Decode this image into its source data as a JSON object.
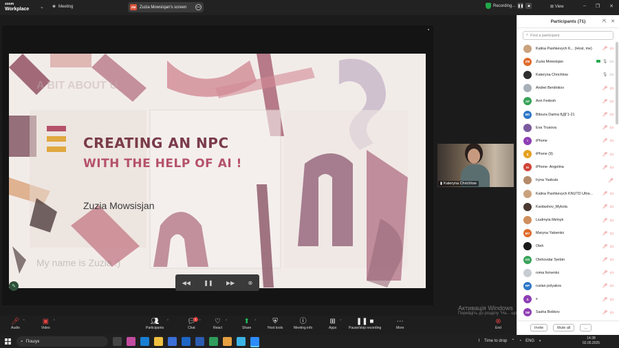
{
  "app": {
    "logo_line1": "zoom",
    "logo_line2": "Workplace"
  },
  "topbar": {
    "meeting_label": "Meeting",
    "share_badge": "ZM",
    "share_label": "Zuzia Mowsisjan's screen",
    "recording_label": "Recording...",
    "view_label": "View"
  },
  "slide": {
    "ghost_top": "A BIT ABOUT U",
    "title_line1": "CREATING AN NPC",
    "title_line2": "WITH THE HELP OF AI !",
    "presenter": "Zuzia Mowsisjan",
    "ghost_bottom": "My name is Zuzia :)"
  },
  "video_tile": {
    "name": "Kateryna Chrichlow"
  },
  "watermark": {
    "line1": "Активація Windows",
    "line2": "Перейдіть до розділу \"На... щоб активувати Windows."
  },
  "participants": {
    "title": "Participants (71)",
    "search_placeholder": "Find a participant",
    "items": [
      {
        "name": "Kalina Pashkevych K... (Host, me)",
        "initials": "",
        "color": "#c9a27e",
        "mic": "off",
        "cam": "off"
      },
      {
        "name": "Zuzia Mowsisjan",
        "initials": "ZM",
        "color": "#e06b2a",
        "mic": "on",
        "cam": "on",
        "sharing": true
      },
      {
        "name": "Kateryna Chrichlow",
        "initials": "",
        "color": "#2f2f2f",
        "mic": "on",
        "cam": "on"
      },
      {
        "name": "Andrei Berdnikov",
        "initials": "",
        "color": "#a7b0b8",
        "mic": "off",
        "cam": "off"
      },
      {
        "name": "Ann Fedesh",
        "initials": "AF",
        "color": "#3aa35a",
        "mic": "off",
        "cam": "off"
      },
      {
        "name": "Bitsura Darina БДГ1-21",
        "initials": "BD",
        "color": "#2f77c9",
        "mic": "off",
        "cam": "off"
      },
      {
        "name": "Eva Trusova",
        "initials": "",
        "color": "#7b5a9c",
        "mic": "off",
        "cam": "off"
      },
      {
        "name": "iPhone",
        "initials": "I",
        "color": "#8e3fb3",
        "mic": "off",
        "cam": "off"
      },
      {
        "name": "iPhone (9)",
        "initials": "I(",
        "color": "#e5a020",
        "mic": "off",
        "cam": "off"
      },
      {
        "name": "iPhone- Angelina",
        "initials": "IA",
        "color": "#d0453a",
        "mic": "off",
        "cam": "off"
      },
      {
        "name": "Iryna Yaskula",
        "initials": "",
        "color": "#b58a6a",
        "mic": "off",
        "cam": "none"
      },
      {
        "name": "Kalina Pashkevych KNUTD Ultra...",
        "initials": "",
        "color": "#c9a27e",
        "mic": "off",
        "cam": "off"
      },
      {
        "name": "Kardashov_Mykola",
        "initials": "",
        "color": "#4a3a32",
        "mic": "off",
        "cam": "off"
      },
      {
        "name": "Liudmyla Melnyk",
        "initials": "",
        "color": "#d08f5e",
        "mic": "off",
        "cam": "off"
      },
      {
        "name": "Maryna Yatsenko",
        "initials": "MY",
        "color": "#e06b2a",
        "mic": "off",
        "cam": "off"
      },
      {
        "name": "Oleh",
        "initials": "",
        "color": "#1b1b1b",
        "mic": "off",
        "cam": "off"
      },
      {
        "name": "Olehovdar Serbin",
        "initials": "OS",
        "color": "#3aa35a",
        "mic": "off",
        "cam": "off"
      },
      {
        "name": "roma fomenko",
        "initials": "",
        "color": "#c6ccd2",
        "mic": "off",
        "cam": "off"
      },
      {
        "name": "ruslan polyakov",
        "initials": "RP",
        "color": "#2f77c9",
        "mic": "off",
        "cam": "off"
      },
      {
        "name": "s",
        "initials": "S",
        "color": "#8e3fb3",
        "mic": "off",
        "cam": "off"
      },
      {
        "name": "Sasha Bobkov",
        "initials": "SB",
        "color": "#8e3fb3",
        "mic": "off",
        "cam": "off"
      }
    ],
    "invite_label": "Invite",
    "mute_all_label": "Mute all",
    "more_label": "..."
  },
  "toolbar": {
    "audio": "Audio",
    "video": "Video",
    "participants": "Participants",
    "participants_count": "71",
    "chat": "Chat",
    "chat_badge": "1",
    "react": "React",
    "share": "Share",
    "host_tools": "Host tools",
    "meeting_info": "Meeting info",
    "apps": "Apps",
    "pause_recording": "Pause/stop recording",
    "more": "More",
    "end": "End"
  },
  "taskbar": {
    "search": "Пошук",
    "tray_text": "Time to drop",
    "lang": "ENG",
    "time": "14:38",
    "date": "02.05.2025"
  }
}
